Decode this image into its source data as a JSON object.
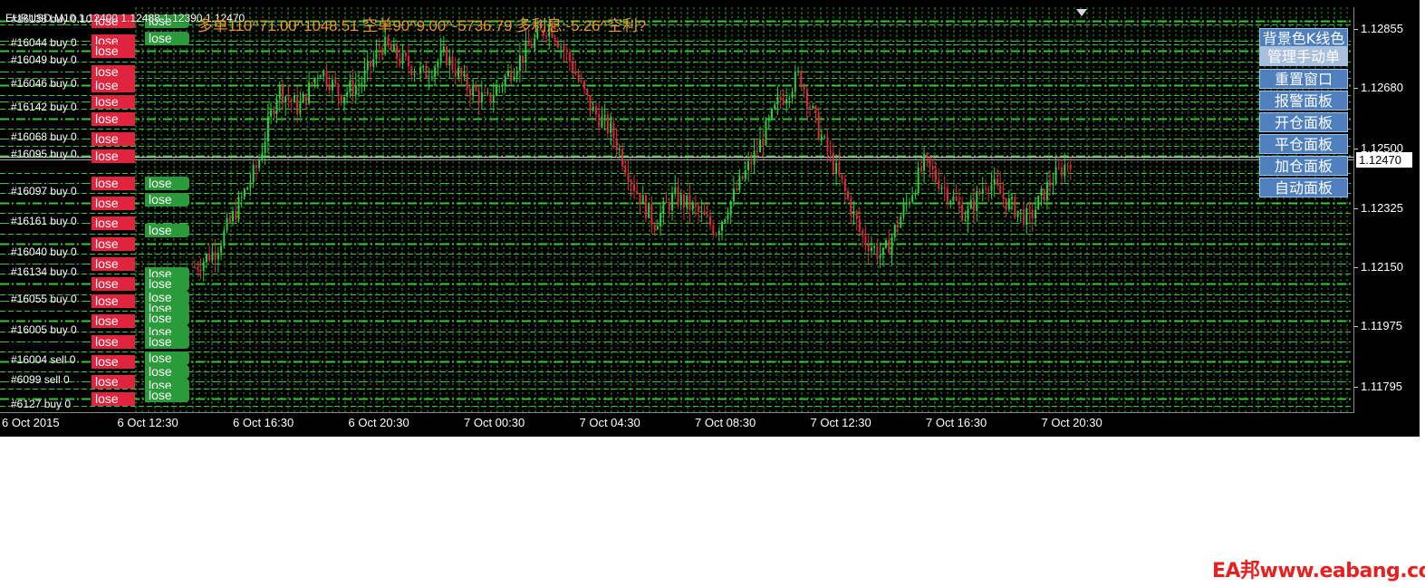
{
  "header": {
    "symbol_info": "EURUSD,M10 1.12400 1.12488 1.12390 1.12470",
    "stats_text": "多单110^71.00^1048.51  空单90^9.00^-5736.79  多利息:-5.26^空利?"
  },
  "side_panel": {
    "buttons": [
      {
        "label": "背景色K线色",
        "active": false
      },
      {
        "label": "管理手动单",
        "active": true
      },
      {
        "label": "重置窗口",
        "active": false
      },
      {
        "label": "报警面板",
        "active": false
      },
      {
        "label": "开仓面板",
        "active": false
      },
      {
        "label": "平仓面板",
        "active": false
      },
      {
        "label": "加仓面板",
        "active": false
      },
      {
        "label": "自动面板",
        "active": false
      }
    ]
  },
  "order_labels": [
    "#16138 buy 0.10",
    "#16044 buy 0",
    "#16049 buy 0",
    "#16046 buy 0",
    "#16142 buy 0",
    "#16068 buy 0",
    "#16095 buy 0",
    "#16097 buy 0",
    "#16161 buy 0",
    "#16040 buy 0",
    "#16134 buy 0",
    "#16055 buy 0",
    "#16005 buy 0",
    "#16004 sell 0",
    "#6099 sell 0",
    "#6127 buy 0"
  ],
  "lose_label": "lose",
  "watermark": "EA邦www.eabang.com",
  "colors": {
    "background": "#000000",
    "grid_green": "#35c535",
    "bull_candle": "#2ecc40",
    "bear_candle": "#e2243c",
    "stats_text": "#f0932e",
    "button_blue": "#4f7fbd",
    "lose_red": "#e0243e",
    "lose_green": "#2a9a3a"
  },
  "chart_data": {
    "type": "candlestick",
    "title": "EURUSD,M10",
    "price_ticks": [
      "1.12855",
      "1.12680",
      "1.12500",
      "1.12325",
      "1.12150",
      "1.11975",
      "1.11795"
    ],
    "current_price": "1.12470",
    "current_price_value": 1.1247,
    "ylim": [
      1.1172,
      1.1292
    ],
    "time_ticks": [
      "6 Oct 2015",
      "6 Oct 12:30",
      "6 Oct 16:30",
      "6 Oct 20:30",
      "7 Oct 00:30",
      "7 Oct 04:30",
      "7 Oct 08:30",
      "7 Oct 12:30",
      "7 Oct 16:30",
      "7 Oct 20:30"
    ],
    "order_levels": [
      1.1288,
      1.1287,
      1.1282,
      1.1281,
      1.1279,
      1.1276,
      1.1273,
      1.1271,
      1.1269,
      1.1266,
      1.1264,
      1.1262,
      1.1259,
      1.1256,
      1.1253,
      1.1251,
      1.1248,
      1.1243,
      1.124,
      1.1237,
      1.1234,
      1.1231,
      1.1228,
      1.1225,
      1.1222,
      1.1219,
      1.1216,
      1.1213,
      1.121,
      1.1207,
      1.1205,
      1.1202,
      1.1199,
      1.1196,
      1.1193,
      1.119,
      1.1187,
      1.1184,
      1.1181,
      1.1179,
      1.1176,
      1.1174
    ],
    "close_path": [
      1.1215,
      1.122,
      1.1232,
      1.1245,
      1.1268,
      1.1262,
      1.1274,
      1.1266,
      1.127,
      1.1281,
      1.1276,
      1.1272,
      1.1278,
      1.1269,
      1.1264,
      1.1272,
      1.128,
      1.1287,
      1.1276,
      1.1262,
      1.1255,
      1.124,
      1.1228,
      1.1236,
      1.1232,
      1.1226,
      1.1238,
      1.125,
      1.1264,
      1.1272,
      1.1254,
      1.124,
      1.1224,
      1.1218,
      1.1232,
      1.1246,
      1.1238,
      1.123,
      1.1241,
      1.1234,
      1.1229,
      1.124,
      1.1247
    ],
    "candle_count": 300,
    "lose_rows": [
      {
        "level": 1.1288,
        "side": "green"
      },
      {
        "level": 1.1283,
        "side": "green"
      },
      {
        "level": 1.124,
        "side": "green"
      },
      {
        "level": 1.1235,
        "side": "green"
      },
      {
        "level": 1.1226,
        "side": "green"
      },
      {
        "level": 1.1213,
        "side": "green"
      },
      {
        "level": 1.121,
        "side": "green"
      },
      {
        "level": 1.1206,
        "side": "green"
      },
      {
        "level": 1.1203,
        "side": "green"
      },
      {
        "level": 1.12,
        "side": "green"
      },
      {
        "level": 1.1196,
        "side": "green"
      },
      {
        "level": 1.1193,
        "side": "green"
      },
      {
        "level": 1.1188,
        "side": "green"
      },
      {
        "level": 1.1184,
        "side": "green"
      },
      {
        "level": 1.118,
        "side": "green"
      },
      {
        "level": 1.1177,
        "side": "green"
      }
    ]
  }
}
